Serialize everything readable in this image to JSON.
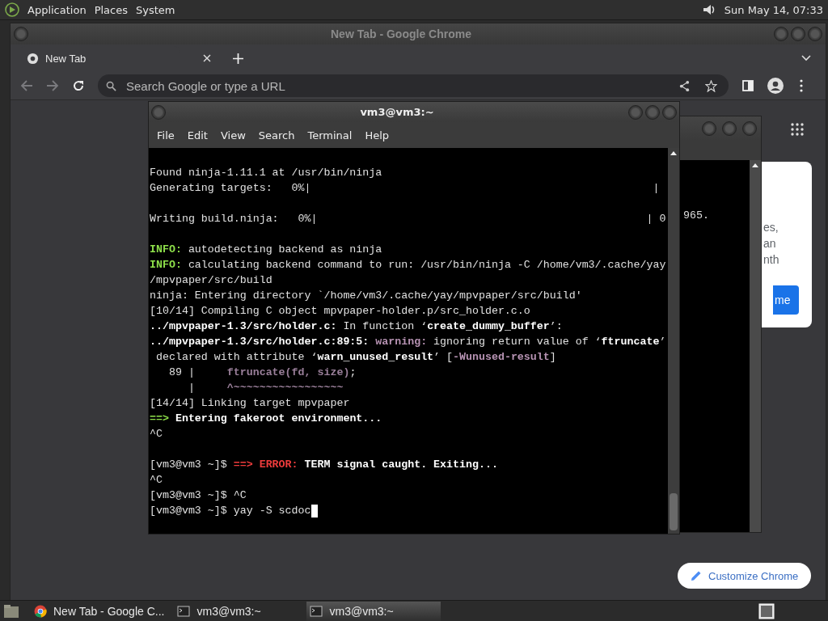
{
  "top_panel": {
    "menus": [
      "Application",
      "Places",
      "System"
    ],
    "clock": "Sun May 14, 07:33"
  },
  "chrome": {
    "title": "New Tab - Google Chrome",
    "tabs": [
      {
        "label": "New Tab",
        "selected": true
      }
    ],
    "back_disabled": true,
    "forward_disabled": true,
    "omnibox": {
      "placeholder": "Search Google or type a URL"
    },
    "card_fragments": [
      "es,",
      "an",
      "nth"
    ],
    "card_button": "me",
    "customize_button": "Customize Chrome"
  },
  "back_terminal": {
    "lines": [
      "965."
    ]
  },
  "terminal": {
    "title": "vm3@vm3:~",
    "menu": [
      "File",
      "Edit",
      "View",
      "Search",
      "Terminal",
      "Help"
    ],
    "cursor_visible": true,
    "lines": [
      {
        "kind": "blank"
      },
      {
        "kind": "text",
        "segments": [
          {
            "text": "Found ninja-1.11.1 at /usr/bin/ninja",
            "kind": "plain"
          }
        ]
      },
      {
        "kind": "text",
        "segments": [
          {
            "text": "Generating targets:   0%|                                                     |",
            "kind": "plain"
          }
        ]
      },
      {
        "kind": "blank"
      },
      {
        "kind": "text",
        "segments": [
          {
            "text": "Writing build.ninja:   0%|                                                   | 0",
            "kind": "plain"
          }
        ]
      },
      {
        "kind": "blank"
      },
      {
        "kind": "text",
        "segments": [
          {
            "text": "INFO:",
            "kind": "info"
          },
          {
            "text": " autodetecting backend as ninja",
            "kind": "plain"
          }
        ]
      },
      {
        "kind": "text",
        "segments": [
          {
            "text": "INFO:",
            "kind": "info"
          },
          {
            "text": " calculating backend command to run: /usr/bin/ninja -C /home/vm3/.cache/yay",
            "kind": "plain"
          }
        ]
      },
      {
        "kind": "text",
        "segments": [
          {
            "text": "/mpvpaper/src/build",
            "kind": "plain"
          }
        ]
      },
      {
        "kind": "text",
        "segments": [
          {
            "text": "ninja: Entering directory `/home/vm3/.cache/yay/mpvpaper/src/build'",
            "kind": "plain"
          }
        ]
      },
      {
        "kind": "text",
        "segments": [
          {
            "text": "[10/14] Compiling C object mpvpaper-holder.p/src_holder.c.o",
            "kind": "plain"
          }
        ]
      },
      {
        "kind": "text",
        "segments": [
          {
            "text": "../mpvpaper-1.3/src/holder.c:",
            "kind": "bold"
          },
          {
            "text": " In function ‘",
            "kind": "plain"
          },
          {
            "text": "create_dummy_buffer",
            "kind": "bold"
          },
          {
            "text": "’:",
            "kind": "plain"
          }
        ]
      },
      {
        "kind": "text",
        "segments": [
          {
            "text": "../mpvpaper-1.3/src/holder.c:89:5:",
            "kind": "bold"
          },
          {
            "text": " warning:",
            "kind": "warn"
          },
          {
            "text": " ignoring return value of ‘",
            "kind": "plain"
          },
          {
            "text": "ftruncate",
            "kind": "bold"
          },
          {
            "text": "’",
            "kind": "plain"
          }
        ]
      },
      {
        "kind": "text",
        "segments": [
          {
            "text": " declared with attribute ‘",
            "kind": "plain"
          },
          {
            "text": "warn_unused_result",
            "kind": "bold"
          },
          {
            "text": "’ [",
            "kind": "plain"
          },
          {
            "text": "-Wunused-result",
            "kind": "flag"
          },
          {
            "text": "]",
            "kind": "plain"
          }
        ]
      },
      {
        "kind": "text",
        "segments": [
          {
            "text": "   89 |     ",
            "kind": "plain"
          },
          {
            "text": "ftruncate(fd, size)",
            "kind": "code"
          },
          {
            "text": ";",
            "kind": "plain"
          }
        ]
      },
      {
        "kind": "text",
        "segments": [
          {
            "text": "      |     ",
            "kind": "plain"
          },
          {
            "text": "^~~~~~~~~~~~~~~~~~",
            "kind": "code"
          }
        ]
      },
      {
        "kind": "text",
        "segments": [
          {
            "text": "[14/14] Linking target mpvpaper",
            "kind": "plain"
          }
        ]
      },
      {
        "kind": "text",
        "segments": [
          {
            "text": "==>",
            "kind": "info"
          },
          {
            "text": " Entering fakeroot environment...",
            "kind": "bold"
          }
        ]
      },
      {
        "kind": "text",
        "segments": [
          {
            "text": "^C",
            "kind": "plain"
          }
        ]
      },
      {
        "kind": "blank"
      },
      {
        "kind": "text",
        "segments": [
          {
            "text": "[vm3@vm3 ~]$ ",
            "kind": "plain"
          },
          {
            "text": "==> ERROR:",
            "kind": "error"
          },
          {
            "text": " TERM signal caught. Exiting...",
            "kind": "bold"
          }
        ]
      },
      {
        "kind": "text",
        "segments": [
          {
            "text": "^C",
            "kind": "plain"
          }
        ]
      },
      {
        "kind": "text",
        "segments": [
          {
            "text": "[vm3@vm3 ~]$ ^C",
            "kind": "plain"
          }
        ]
      },
      {
        "kind": "text",
        "segments": [
          {
            "text": "[vm3@vm3 ~]$ yay -S scdoc",
            "kind": "plain"
          }
        ]
      }
    ]
  },
  "taskbar": {
    "items": [
      {
        "label": "New Tab - Google C...",
        "kind": "browser",
        "selected": false
      },
      {
        "label": "vm3@vm3:~",
        "kind": "terminal",
        "selected": false
      },
      {
        "label": "vm3@vm3:~",
        "kind": "terminal",
        "selected": true
      }
    ]
  }
}
